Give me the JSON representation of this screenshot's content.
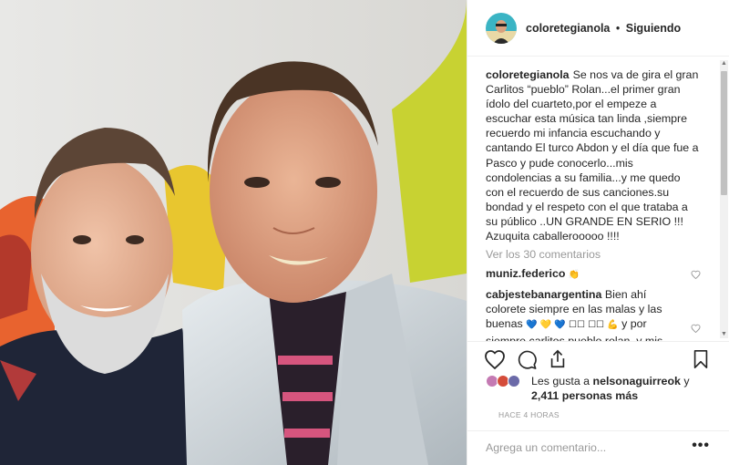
{
  "post": {
    "username": "coloretegianola",
    "separator": "•",
    "follow_status": "Siguiendo",
    "caption": "Se nos va de gira el gran Carlitos “pueblo” Rolan...el primer gran ídolo del cuarteto,por el empeze a escuchar esta música tan linda ,siempre recuerdo mi infancia escuchando y cantando El turco Abdon y el día que fue a Pasco y pude conocerlo...mis condolencias a su familia...y me quedo con el recuerdo de sus canciones.su bondad y el respeto con el que trataba a su público ..UN GRANDE EN SERIO !!! Azuquita caballerooooo !!!!",
    "view_all_comments": "Ver los 30 comentarios"
  },
  "comments": [
    {
      "username": "muniz.federico",
      "text": "",
      "emoji": "👏"
    },
    {
      "username": "cabjestebanargentina",
      "text_before": "Bien ahí colorete siempre en las malas y las buenas ",
      "emoji": "💙 💛 💙 ☐☐ ☐☐ 💪",
      "text_after": " y por siempre carlitos pueblo rolan, y mis condolencias asus familiares y amigos"
    }
  ],
  "likes": {
    "prefix": "Les gusta a ",
    "user": "nelsonaguirreok",
    "middle": " y",
    "count": "2,411 personas más"
  },
  "timestamp": "HACE 4 HORAS",
  "comment_box": {
    "placeholder": "Agrega un comentario..."
  },
  "more_options": "•••",
  "icons": {
    "like": "heart-icon",
    "comment": "comment-bubble-icon",
    "share": "share-icon",
    "save": "bookmark-icon"
  },
  "colors": {
    "text": "#262626",
    "muted": "#999999",
    "border": "#efefef"
  }
}
